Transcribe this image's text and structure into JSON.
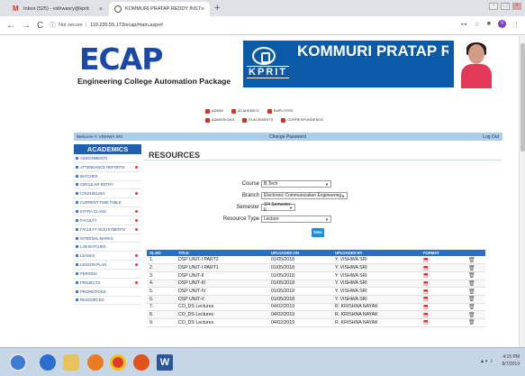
{
  "browser": {
    "tab1_title": "Inbox (525) - vishwasry@kprit",
    "tab2_title": "KOMMURI PRATAP REDDY INST",
    "security_label": "Not secure",
    "url": "119.235.55.173/ecap/main.aspx#"
  },
  "header": {
    "logo": "ECAP",
    "tagline": "Engineering College Automation Package",
    "kprit": "KPRIT",
    "college_name": "KOMMURI PRATAP RE INSTITUTE OF TECHNO"
  },
  "menu": {
    "row1": [
      "ADMIN",
      "ACADEMICS",
      "EMPLOYEE"
    ],
    "row2": [
      "ADMISSIONS",
      "PLACEMENTS",
      "CORRESPONDENCE"
    ]
  },
  "bar": {
    "welcome": "Welcome Y. VISHWA SRI",
    "change_password": "Change Password",
    "logout": "Log Out"
  },
  "sidebar": {
    "title": "ACADEMICS",
    "items": [
      {
        "label": "ASSIGNMENTS",
        "dot": false
      },
      {
        "label": "ATTENDANCE REPORTS",
        "dot": true
      },
      {
        "label": "BATCHES",
        "dot": false
      },
      {
        "label": "CIRCULAR ENTRY",
        "dot": false
      },
      {
        "label": "COUNSELING",
        "dot": true
      },
      {
        "label": "CURRENT TIME TABLE",
        "dot": false
      },
      {
        "label": "EXTRA CLASS",
        "dot": true
      },
      {
        "label": "FACULTY",
        "dot": true
      },
      {
        "label": "FACULTY ADJUSTMENTS",
        "dot": true
      },
      {
        "label": "INTERNAL MARKS",
        "dot": false
      },
      {
        "label": "LAB BATCHES",
        "dot": false
      },
      {
        "label": "LEAVES",
        "dot": true
      },
      {
        "label": "LESSON PLAN",
        "dot": true
      },
      {
        "label": "PERIODS",
        "dot": false
      },
      {
        "label": "PROJECTS",
        "dot": true
      },
      {
        "label": "PROMOTIONS",
        "dot": false
      },
      {
        "label": "RESOURCES",
        "dot": false
      }
    ]
  },
  "resources": {
    "title": "RESOURCES",
    "course_label": "Course",
    "course_value": "B.Tech",
    "branch_label": "Branch",
    "branch_value": "Electronic Communication Engineering",
    "semester_label": "Semester",
    "semester_value": "3/4 Semester-II",
    "type_label": "Resource Type",
    "type_value": "Lecture",
    "new_button": "New",
    "columns": [
      "SL.NO",
      "TITLE",
      "UPLOADED ON",
      "UPLOADED BY",
      "FORMAT"
    ],
    "rows": [
      [
        "1.",
        "DSP UNIT-I PART2",
        "01/05/2018",
        "Y. VISHWA SRI"
      ],
      [
        "2.",
        "DSP UNIT-I PART1",
        "01/05/2018",
        "Y. VISHWA SRI"
      ],
      [
        "3.",
        "DSP UNIT-II",
        "01/05/2018",
        "Y. VISHWA SRI"
      ],
      [
        "4.",
        "DSP UNIT-III",
        "01/05/2018",
        "Y. VISHWA SRI"
      ],
      [
        "5.",
        "DSP UNIT-IV",
        "01/05/2018",
        "Y. VISHWA SRI"
      ],
      [
        "6.",
        "DSP UNIT-V",
        "01/05/2018",
        "Y. VISHWA SRI"
      ],
      [
        "7.",
        "CO_DS Lectures",
        "04/02/2019",
        "R. KRISHNA NAYAK"
      ],
      [
        "8.",
        "CO_DS Lectures",
        "04/02/2019",
        "R. KRISHNA NAYAK"
      ],
      [
        "9.",
        "CO_DS Lectures",
        "04/02/2019",
        "R. KRISHNA NAYAK"
      ]
    ]
  },
  "taskbar": {
    "time": "4:15 PM",
    "date": "8/7/2019"
  }
}
